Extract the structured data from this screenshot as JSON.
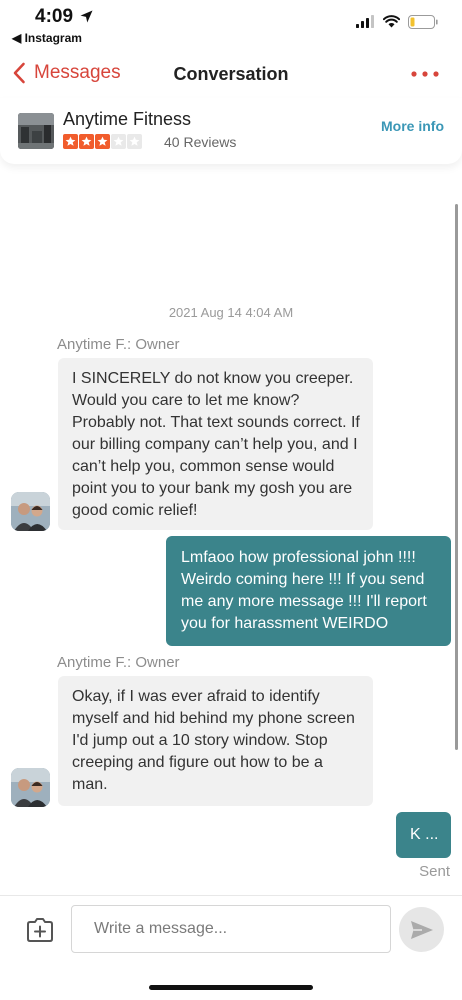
{
  "status_bar": {
    "time": "4:09",
    "back_app": "◀ Instagram"
  },
  "nav": {
    "back_label": "Messages",
    "title": "Conversation"
  },
  "business": {
    "name": "Anytime Fitness",
    "rating": 3,
    "max_rating": 5,
    "reviews": "40 Reviews",
    "more_info": "More info"
  },
  "conversation": {
    "timestamp": "2021 Aug 14 4:04 AM",
    "messages": [
      {
        "from": "owner",
        "sender": "Anytime F.: Owner",
        "text": "I SINCERELY do not know you creeper. Would you care to let me know? Probably not. That text sounds correct. If our billing company can’t help you, and I can’t help you, common sense would point you to your bank my gosh you are good comic relief!"
      },
      {
        "from": "me",
        "text": "Lmfaoo how professional john !!!! Weirdo coming here !!! If you send me any more message !!! I'll report you for harassment WEIRDO"
      },
      {
        "from": "owner",
        "sender": "Anytime F.: Owner",
        "text": "Okay, if I was ever afraid to identify myself and hid behind my phone screen I'd jump out a 10 story window. Stop creeping and figure out how to be a man."
      },
      {
        "from": "me",
        "text": "K ..."
      }
    ],
    "sent_status": "Sent"
  },
  "composer": {
    "placeholder": "Write a message...",
    "value": ""
  },
  "colors": {
    "accent_red": "#d7453b",
    "star_orange": "#f15c2c",
    "link_blue": "#3b97b6",
    "outgoing_bubble": "#3b848b",
    "incoming_bubble": "#f1f1f1"
  },
  "icons": [
    "location-arrow-icon",
    "signal-icon",
    "wifi-icon",
    "battery-icon",
    "chevron-left-icon",
    "more-dots-icon",
    "star-icon",
    "add-photo-icon",
    "send-icon"
  ]
}
